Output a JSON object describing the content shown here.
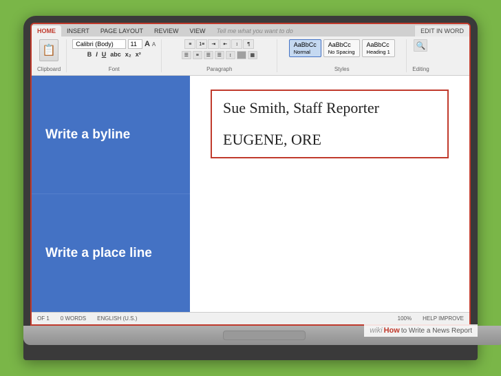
{
  "laptop": {
    "screen_border_color": "#c0392b"
  },
  "ribbon": {
    "tabs": [
      "HOME",
      "INSERT",
      "PAGE LAYOUT",
      "REVIEW",
      "VIEW"
    ],
    "active_tab": "HOME",
    "tell_placeholder": "Tell me what you want to do",
    "edit_in_word": "EDIT IN WORD",
    "font_name": "Calibri (Body)",
    "font_size": "11",
    "sections": {
      "clipboard": "Clipboard",
      "font": "Font",
      "paragraph": "Paragraph",
      "styles": "Styles",
      "editing": "Editing"
    },
    "style_buttons": [
      "AaBbCc Normal",
      "AaBbCc No Spacing",
      "AaBbCc Heading 1"
    ]
  },
  "labels": [
    {
      "id": "byline",
      "text": "Write a byline"
    },
    {
      "id": "placeline",
      "text": "Write a place line"
    }
  ],
  "document": {
    "byline_text": "Sue Smith, Staff Reporter",
    "placeline_text": "EUGENE, ORE"
  },
  "status_bar": {
    "page": "OF 1",
    "words": "0 WORDS",
    "language": "ENGLISH (U.S.)",
    "zoom": "100%",
    "help": "HELP IMPROVE"
  },
  "wikihow": {
    "wiki": "wiki",
    "how": "How",
    "text": "to Write a News Report"
  }
}
